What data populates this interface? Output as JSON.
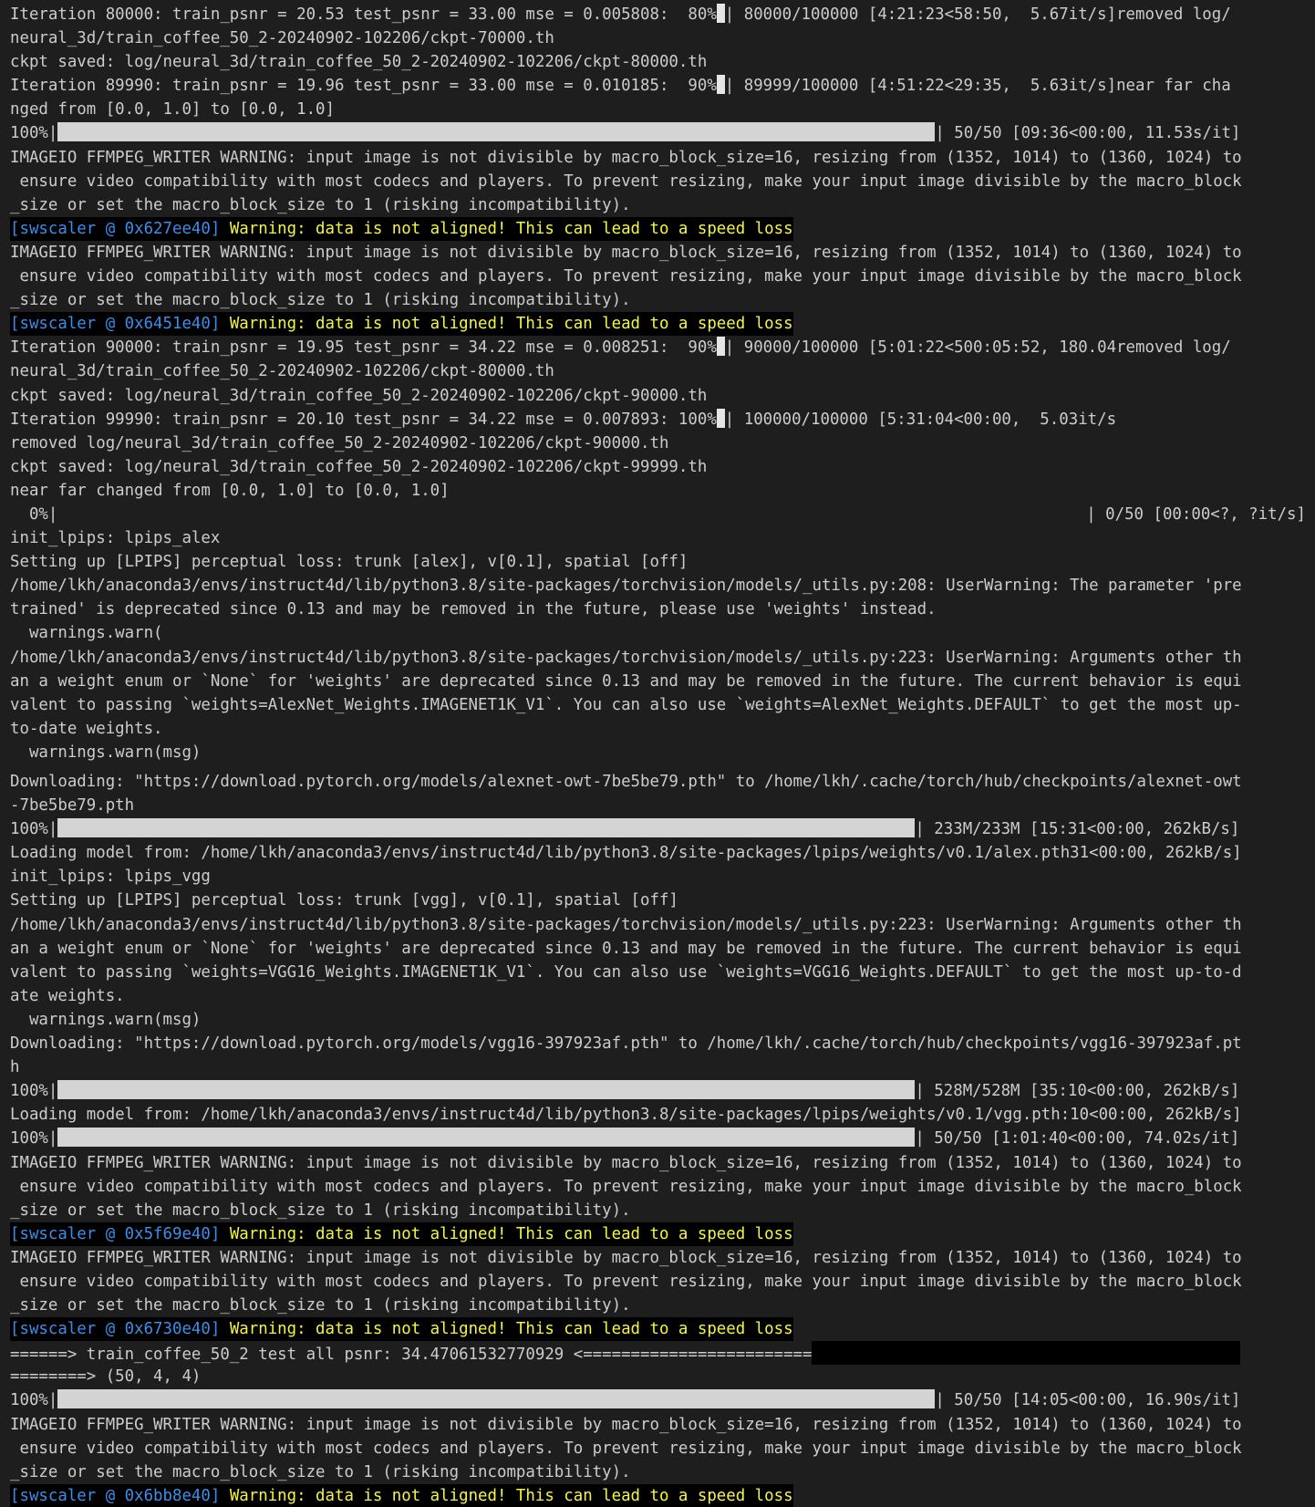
{
  "terminal": {
    "lines": [
      {
        "kind": "text",
        "text": "Iteration 80000: train_psnr = 20.53 test_psnr = 33.00 mse = 0.005808:  80%",
        "tail": "| 80000/100000 [4:21:23<58:50,  5.67it/s]removed log/",
        "cursor": true
      },
      {
        "kind": "text",
        "text": "neural_3d/train_coffee_50_2-20240902-102206/ckpt-70000.th"
      },
      {
        "kind": "text",
        "text": "ckpt saved: log/neural_3d/train_coffee_50_2-20240902-102206/ckpt-80000.th"
      },
      {
        "kind": "text",
        "text": "Iteration 89990: train_psnr = 19.96 test_psnr = 33.00 mse = 0.010185:  90%",
        "tail": "| 89999/100000 [4:51:22<29:35,  5.63it/s]near far cha",
        "cursor": true
      },
      {
        "kind": "text",
        "text": "nged from [0.0, 1.0] to [0.0, 1.0]"
      },
      {
        "kind": "bar",
        "prefix": "100%|",
        "suffix": "| 50/50 [09:36<00:00, 11.53s/it]",
        "barClass": "b1"
      },
      {
        "kind": "text",
        "text": "IMAGEIO FFMPEG_WRITER WARNING: input image is not divisible by macro_block_size=16, resizing from (1352, 1014) to (1360, 1024) to"
      },
      {
        "kind": "text",
        "text": " ensure video compatibility with most codecs and players. To prevent resizing, make your input image divisible by the macro_block"
      },
      {
        "kind": "text",
        "text": "_size or set the macro_block_size to 1 (risking incompatibility)."
      },
      {
        "kind": "warn",
        "tag": "[swscaler @ 0x627ee40]",
        "msg": " Warning: data is not aligned! This can lead to a speed loss"
      },
      {
        "kind": "text",
        "text": "IMAGEIO FFMPEG_WRITER WARNING: input image is not divisible by macro_block_size=16, resizing from (1352, 1014) to (1360, 1024) to"
      },
      {
        "kind": "text",
        "text": " ensure video compatibility with most codecs and players. To prevent resizing, make your input image divisible by the macro_block"
      },
      {
        "kind": "text",
        "text": "_size or set the macro_block_size to 1 (risking incompatibility)."
      },
      {
        "kind": "warn",
        "tag": "[swscaler @ 0x6451e40]",
        "msg": " Warning: data is not aligned! This can lead to a speed loss"
      },
      {
        "kind": "text",
        "text": "Iteration 90000: train_psnr = 19.95 test_psnr = 34.22 mse = 0.008251:  90%",
        "tail": "| 90000/100000 [5:01:22<500:05:52, 180.04removed log/",
        "cursor": true
      },
      {
        "kind": "text",
        "text": "neural_3d/train_coffee_50_2-20240902-102206/ckpt-80000.th"
      },
      {
        "kind": "text",
        "text": "ckpt saved: log/neural_3d/train_coffee_50_2-20240902-102206/ckpt-90000.th"
      },
      {
        "kind": "text",
        "text": "Iteration 99990: train_psnr = 20.10 test_psnr = 34.22 mse = 0.007893: 100%",
        "tail": "| 100000/100000 [5:31:04<00:00,  5.03it/s",
        "cursor": true
      },
      {
        "kind": "text",
        "text": "removed log/neural_3d/train_coffee_50_2-20240902-102206/ckpt-90000.th"
      },
      {
        "kind": "text",
        "text": "ckpt saved: log/neural_3d/train_coffee_50_2-20240902-102206/ckpt-99999.th"
      },
      {
        "kind": "text",
        "text": "near far changed from [0.0, 1.0] to [0.0, 1.0]"
      },
      {
        "kind": "split",
        "left": "  0%|",
        "right": "| 0/50 [00:00<?, ?it/s]"
      },
      {
        "kind": "text",
        "text": "init_lpips: lpips_alex"
      },
      {
        "kind": "text",
        "text": "Setting up [LPIPS] perceptual loss: trunk [alex], v[0.1], spatial [off]"
      },
      {
        "kind": "text",
        "text": "/home/lkh/anaconda3/envs/instruct4d/lib/python3.8/site-packages/torchvision/models/_utils.py:208: UserWarning: The parameter 'pre"
      },
      {
        "kind": "text",
        "text": "trained' is deprecated since 0.13 and may be removed in the future, please use 'weights' instead."
      },
      {
        "kind": "text",
        "text": "  warnings.warn("
      },
      {
        "kind": "text",
        "text": "/home/lkh/anaconda3/envs/instruct4d/lib/python3.8/site-packages/torchvision/models/_utils.py:223: UserWarning: Arguments other th"
      },
      {
        "kind": "text",
        "text": "an a weight enum or `None` for 'weights' are deprecated since 0.13 and may be removed in the future. The current behavior is equi"
      },
      {
        "kind": "text",
        "text": "valent to passing `weights=AlexNet_Weights.IMAGENET1K_V1`. You can also use `weights=AlexNet_Weights.DEFAULT` to get the most up-"
      },
      {
        "kind": "text",
        "text": "to-date weights."
      },
      {
        "kind": "text",
        "text": "  warnings.warn(msg)"
      },
      {
        "kind": "gap"
      },
      {
        "kind": "text",
        "text": "Downloading: \"https://download.pytorch.org/models/alexnet-owt-7be5be79.pth\" to /home/lkh/.cache/torch/hub/checkpoints/alexnet-owt"
      },
      {
        "kind": "text",
        "text": "-7be5be79.pth"
      },
      {
        "kind": "bar",
        "prefix": "100%|",
        "suffix": "| 233M/233M [15:31<00:00, 262kB/s]",
        "barClass": "b2"
      },
      {
        "kind": "text",
        "text": "Loading model from: /home/lkh/anaconda3/envs/instruct4d/lib/python3.8/site-packages/lpips/weights/v0.1/alex.pth31<00:00, 262kB/s]"
      },
      {
        "kind": "text",
        "text": "init_lpips: lpips_vgg"
      },
      {
        "kind": "text",
        "text": "Setting up [LPIPS] perceptual loss: trunk [vgg], v[0.1], spatial [off]"
      },
      {
        "kind": "text",
        "text": "/home/lkh/anaconda3/envs/instruct4d/lib/python3.8/site-packages/torchvision/models/_utils.py:223: UserWarning: Arguments other th"
      },
      {
        "kind": "text",
        "text": "an a weight enum or `None` for 'weights' are deprecated since 0.13 and may be removed in the future. The current behavior is equi"
      },
      {
        "kind": "text",
        "text": "valent to passing `weights=VGG16_Weights.IMAGENET1K_V1`. You can also use `weights=VGG16_Weights.DEFAULT` to get the most up-to-d"
      },
      {
        "kind": "text",
        "text": "ate weights."
      },
      {
        "kind": "text",
        "text": "  warnings.warn(msg)"
      },
      {
        "kind": "text",
        "text": "Downloading: \"https://download.pytorch.org/models/vgg16-397923af.pth\" to /home/lkh/.cache/torch/hub/checkpoints/vgg16-397923af.pt"
      },
      {
        "kind": "text",
        "text": "h"
      },
      {
        "kind": "bar",
        "prefix": "100%|",
        "suffix": "| 528M/528M [35:10<00:00, 262kB/s]",
        "barClass": "b2"
      },
      {
        "kind": "text",
        "text": "Loading model from: /home/lkh/anaconda3/envs/instruct4d/lib/python3.8/site-packages/lpips/weights/v0.1/vgg.pth:10<00:00, 262kB/s]"
      },
      {
        "kind": "bar",
        "prefix": "100%|",
        "suffix": "| 50/50 [1:01:40<00:00, 74.02s/it]",
        "barClass": "b2"
      },
      {
        "kind": "text",
        "text": "IMAGEIO FFMPEG_WRITER WARNING: input image is not divisible by macro_block_size=16, resizing from (1352, 1014) to (1360, 1024) to"
      },
      {
        "kind": "text",
        "text": " ensure video compatibility with most codecs and players. To prevent resizing, make your input image divisible by the macro_block"
      },
      {
        "kind": "text",
        "text": "_size or set the macro_block_size to 1 (risking incompatibility)."
      },
      {
        "kind": "warn",
        "tag": "[swscaler @ 0x5f69e40]",
        "msg": " Warning: data is not aligned! This can lead to a speed loss"
      },
      {
        "kind": "text",
        "text": "IMAGEIO FFMPEG_WRITER WARNING: input image is not divisible by macro_block_size=16, resizing from (1352, 1014) to (1360, 1024) to"
      },
      {
        "kind": "text",
        "text": " ensure video compatibility with most codecs and players. To prevent resizing, make your input image divisible by the macro_block"
      },
      {
        "kind": "text",
        "text": "_size or set the macro_block_size to 1 (risking incompatibility)."
      },
      {
        "kind": "warn",
        "tag": "[swscaler @ 0x6730e40]",
        "msg": " Warning: data is not aligned! This can lead to a speed loss"
      },
      {
        "kind": "psnr",
        "text": "======> train_coffee_50_2 test all psnr: 34.47061532770929 <========================"
      },
      {
        "kind": "text",
        "text": "========> (50, 4, 4)"
      },
      {
        "kind": "bar",
        "prefix": "100%|",
        "suffix": "| 50/50 [14:05<00:00, 16.90s/it]",
        "barClass": "b1"
      },
      {
        "kind": "text",
        "text": "IMAGEIO FFMPEG_WRITER WARNING: input image is not divisible by macro_block_size=16, resizing from (1352, 1014) to (1360, 1024) to"
      },
      {
        "kind": "text",
        "text": " ensure video compatibility with most codecs and players. To prevent resizing, make your input image divisible by the macro_block"
      },
      {
        "kind": "text",
        "text": "_size or set the macro_block_size to 1 (risking incompatibility)."
      },
      {
        "kind": "warn",
        "tag": "[swscaler @ 0x6bb8e40]",
        "msg": " Warning: data is not aligned! This can lead to a speed loss"
      }
    ]
  },
  "colors": {
    "background": "#1e1e1e",
    "foreground": "#cccccc",
    "swscaler_tag": "#3b8eea",
    "warning_text": "#f5f543",
    "progress_fill": "#d4d4d4"
  }
}
